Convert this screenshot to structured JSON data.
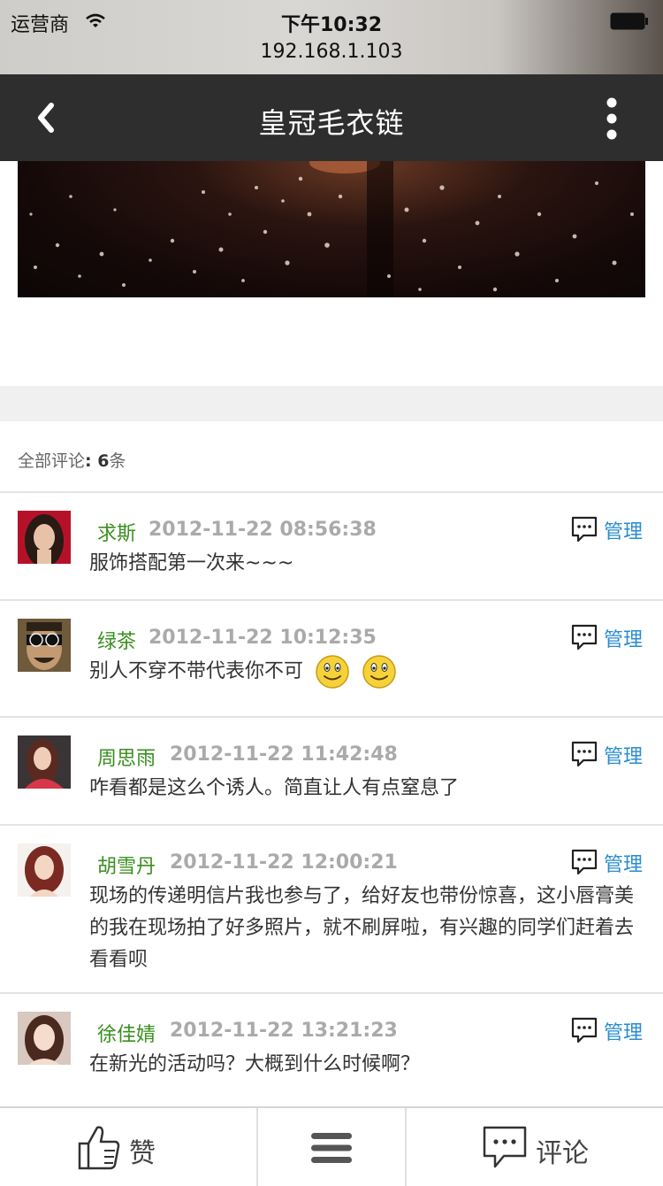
{
  "status_bar": {
    "carrier": "运营商",
    "time": "下午10:32",
    "url": "192.168.1.103"
  },
  "nav": {
    "title": "皇冠毛衣链"
  },
  "comments_header": {
    "label": "全部评论",
    "separator": ": ",
    "count": "6",
    "unit": "条"
  },
  "comments": [
    {
      "name": "求斯",
      "time": "2012-11-22 08:56:38",
      "text": "服饰搭配第一次来~~~",
      "action": "管理"
    },
    {
      "name": "绿茶",
      "time": "2012-11-22 10:12:35",
      "text": "别人不穿不带代表你不可",
      "action": "管理",
      "emoji": [
        "smiley-icon",
        "smiley-icon"
      ]
    },
    {
      "name": "周思雨",
      "time": "2012-11-22 11:42:48",
      "text": "咋看都是这么个诱人。简直让人有点窒息了",
      "action": "管理"
    },
    {
      "name": "胡雪丹",
      "time": "2012-11-22 12:00:21",
      "text": "现场的传递明信片我也参与了，给好友也带份惊喜，这小唇膏美的我在现场拍了好多照片，就不刷屏啦，有兴趣的同学们赶着去看看呗",
      "action": "管理"
    },
    {
      "name": "徐佳婧",
      "time": "2012-11-22 13:21:23",
      "text": "在新光的活动吗？大概到什么时候啊？",
      "action": "管理"
    }
  ],
  "toolbar": {
    "like_label": "赞",
    "comment_label": "评论"
  },
  "colors": {
    "nav_bg": "#2e2e2e",
    "name_green": "#3a8f1f",
    "manage_blue": "#2a8ccf"
  }
}
